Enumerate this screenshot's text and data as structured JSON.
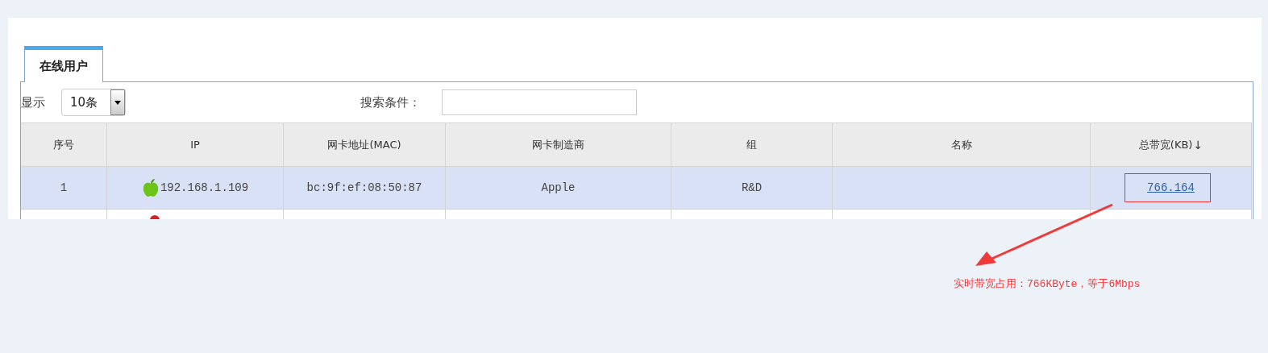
{
  "tabs": [
    {
      "label": "在线用户",
      "selected": true
    }
  ],
  "toolbar": {
    "show_label": "显示",
    "page_size": "10条",
    "search_label": "搜索条件："
  },
  "table": {
    "columns": [
      {
        "label": "序号"
      },
      {
        "label": "IP"
      },
      {
        "label": "网卡地址(MAC)"
      },
      {
        "label": "网卡制造商"
      },
      {
        "label": "组"
      },
      {
        "label": "名称"
      },
      {
        "label": "总带宽(KB)",
        "sort_arrow": "↓"
      }
    ],
    "rows": [
      {
        "selected": true,
        "index": "1",
        "ip": "192.168.1.109",
        "mac": "bc:9f:ef:08:50:87",
        "vendor": "Apple",
        "group": "R&D",
        "bandwidth": "766.164"
      },
      {
        "selected": false
      }
    ]
  },
  "annotation": {
    "text": "实时带宽占用：766KByte，等于6Mbps"
  }
}
